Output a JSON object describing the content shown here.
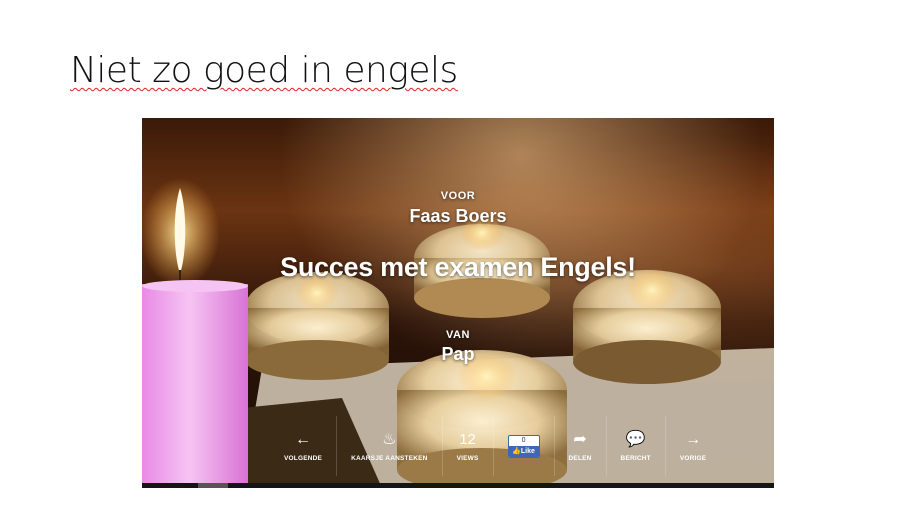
{
  "slide": {
    "title": "Niet zo goed in engels"
  },
  "card": {
    "voor_label": "VOOR",
    "recipient": "Faas Boers",
    "message": "Succes met examen Engels!",
    "van_label": "VAN",
    "sender": "Pap"
  },
  "actions": {
    "next": {
      "icon": "arrow-left-icon",
      "label": "VOLGENDE"
    },
    "light_candle": {
      "icon": "flame-icon",
      "label": "KAARSJE AANSTEKEN"
    },
    "views": {
      "count": "12",
      "label": "VIEWS"
    },
    "facebook": {
      "count": "0",
      "label": "Like"
    },
    "share": {
      "icon": "share-icon",
      "label": "DELEN"
    },
    "message": {
      "icon": "speech-bubble-icon",
      "label": "BERICHT"
    },
    "previous": {
      "icon": "arrow-right-icon",
      "label": "VORIGE"
    }
  },
  "colors": {
    "candle": "#f2a8ee",
    "facebook": "#4267b2",
    "spellcheck": "#e02020"
  }
}
